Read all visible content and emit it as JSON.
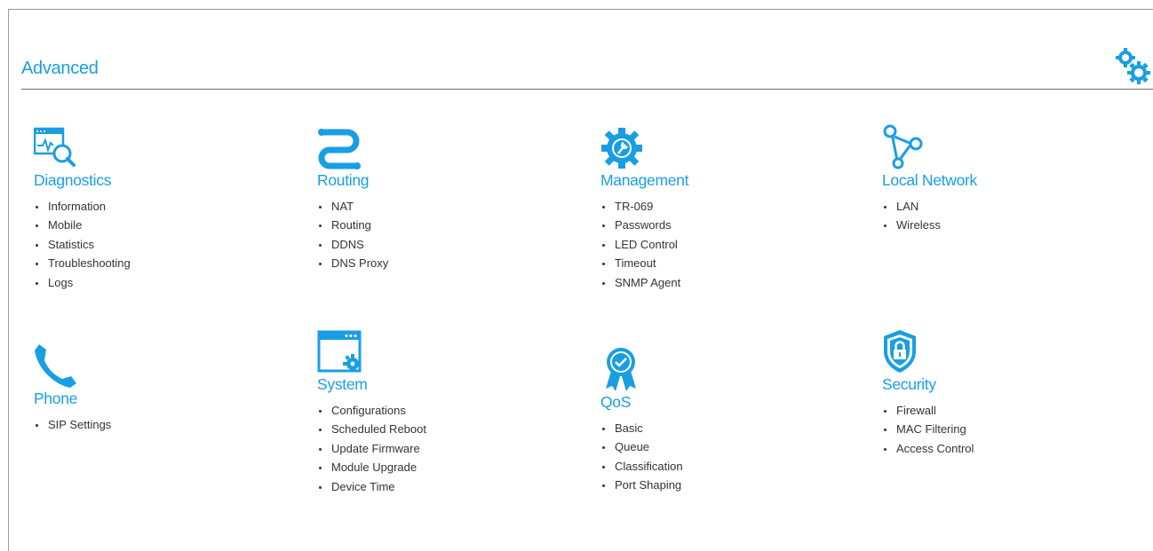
{
  "page": {
    "title": "Advanced",
    "accent_color": "#1a9ee3",
    "settings_icon": "gears-icon"
  },
  "sections": {
    "diagnostics": {
      "title": "Diagnostics",
      "icon": "diagnostics-monitor-icon",
      "items": [
        "Information",
        "Mobile",
        "Statistics",
        "Troubleshooting",
        "Logs"
      ]
    },
    "routing": {
      "title": "Routing",
      "icon": "routing-path-icon",
      "items": [
        "NAT",
        "Routing",
        "DDNS",
        "DNS Proxy"
      ]
    },
    "management": {
      "title": "Management",
      "icon": "management-gear-wrench-icon",
      "items": [
        "TR-069",
        "Passwords",
        "LED Control",
        "Timeout",
        "SNMP Agent"
      ]
    },
    "local_network": {
      "title": "Local Network",
      "icon": "network-nodes-icon",
      "items": [
        "LAN",
        "Wireless"
      ]
    },
    "phone": {
      "title": "Phone",
      "icon": "phone-icon",
      "items": [
        "SIP Settings"
      ]
    },
    "system": {
      "title": "System",
      "icon": "system-window-gear-icon",
      "items": [
        "Configurations",
        "Scheduled Reboot",
        "Update Firmware",
        "Module Upgrade",
        "Device Time"
      ]
    },
    "qos": {
      "title": "QoS",
      "icon": "qos-badge-icon",
      "items": [
        "Basic",
        "Queue",
        "Classification",
        "Port Shaping"
      ]
    },
    "security": {
      "title": "Security",
      "icon": "security-shield-lock-icon",
      "items": [
        "Firewall",
        "MAC Filtering",
        "Access Control"
      ]
    }
  }
}
